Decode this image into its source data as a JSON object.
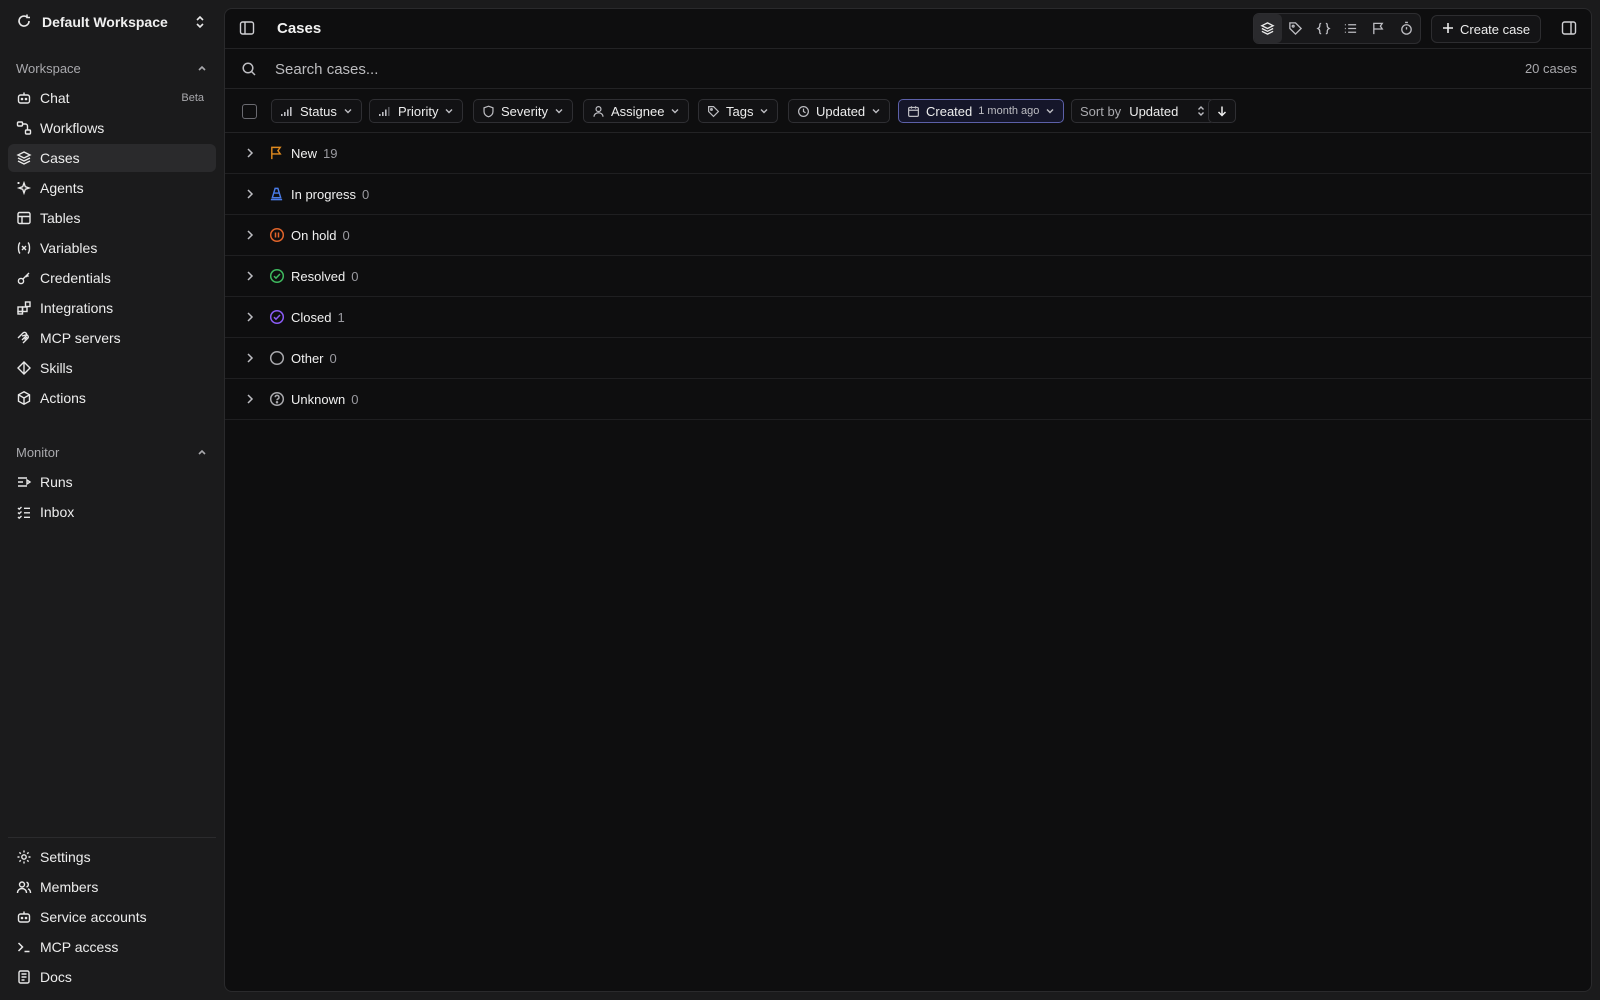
{
  "workspace": {
    "name": "Default Workspace"
  },
  "sidebar": {
    "workspace_section": "Workspace",
    "items": [
      {
        "label": "Chat",
        "badge": "Beta",
        "icon": "bot-icon"
      },
      {
        "label": "Workflows",
        "icon": "workflow-icon"
      },
      {
        "label": "Cases",
        "icon": "layers-icon",
        "active": true
      },
      {
        "label": "Agents",
        "icon": "sparkles-icon"
      },
      {
        "label": "Tables",
        "icon": "table-icon"
      },
      {
        "label": "Variables",
        "icon": "variable-icon"
      },
      {
        "label": "Credentials",
        "icon": "key-icon"
      },
      {
        "label": "Integrations",
        "icon": "blocks-icon"
      },
      {
        "label": "MCP servers",
        "icon": "mcp-icon"
      },
      {
        "label": "Skills",
        "icon": "diamond-icon"
      },
      {
        "label": "Actions",
        "icon": "box-icon"
      }
    ],
    "monitor_section": "Monitor",
    "monitor_items": [
      {
        "label": "Runs",
        "icon": "runs-icon"
      },
      {
        "label": "Inbox",
        "icon": "inbox-icon"
      }
    ],
    "bottom_items": [
      {
        "label": "Settings",
        "icon": "gear-icon"
      },
      {
        "label": "Members",
        "icon": "users-icon"
      },
      {
        "label": "Service accounts",
        "icon": "bot-icon"
      },
      {
        "label": "MCP access",
        "icon": "terminal-icon"
      },
      {
        "label": "Docs",
        "icon": "book-icon"
      }
    ]
  },
  "header": {
    "title": "Cases",
    "create_label": "Create case"
  },
  "search": {
    "placeholder": "Search cases...",
    "count": "20 cases"
  },
  "filters": {
    "status": "Status",
    "priority": "Priority",
    "severity": "Severity",
    "assignee": "Assignee",
    "tags": "Tags",
    "updated": "Updated",
    "created": "Created",
    "created_value": "1 month ago",
    "sort_by": "Sort by",
    "sort_value": "Updated"
  },
  "groups": [
    {
      "name": "New",
      "count": "19",
      "icon": "flag-icon",
      "color": "#e08a1e"
    },
    {
      "name": "In progress",
      "count": "0",
      "icon": "traffic-cone-icon",
      "color": "#4a7ce8"
    },
    {
      "name": "On hold",
      "count": "0",
      "icon": "pause-circle-icon",
      "color": "#e0642a"
    },
    {
      "name": "Resolved",
      "count": "0",
      "icon": "check-circle-icon",
      "color": "#3fb95f"
    },
    {
      "name": "Closed",
      "count": "1",
      "icon": "check-circle-icon",
      "color": "#8b5cf6"
    },
    {
      "name": "Other",
      "count": "0",
      "icon": "circle-icon",
      "color": "#a9a9ad"
    },
    {
      "name": "Unknown",
      "count": "0",
      "icon": "help-circle-icon",
      "color": "#a9a9ad"
    }
  ]
}
